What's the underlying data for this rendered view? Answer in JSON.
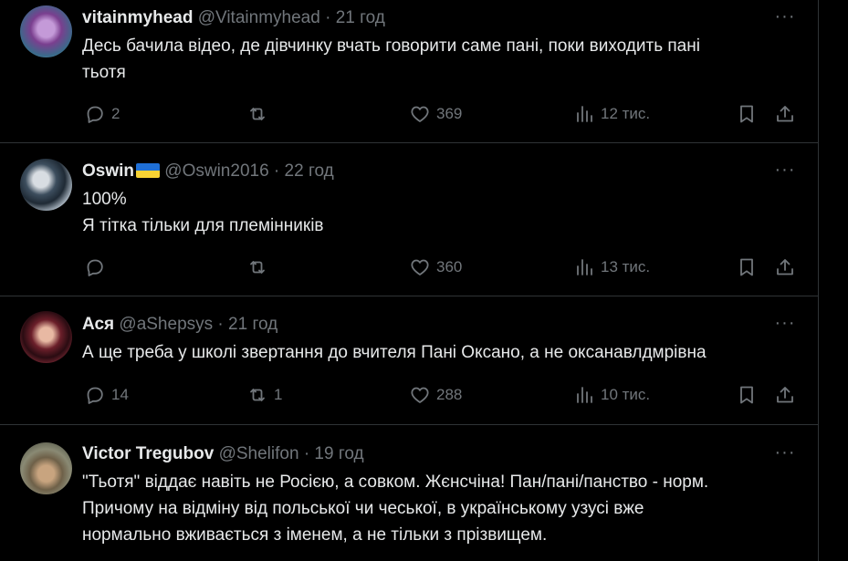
{
  "tweets": [
    {
      "name": "vitainmyhead",
      "handle": "@Vitainmyhead",
      "sep": "·",
      "time": "21 год",
      "text_lines": [
        "Десь бачила відео, де дівчинку вчать говорити саме пані, поки виходить пані",
        "тьотя"
      ],
      "replies": "2",
      "reposts": "",
      "likes": "369",
      "views": "12 тис."
    },
    {
      "name": "Oswin",
      "flag": "ukraine-flag",
      "handle": "@Oswin2016",
      "sep": "·",
      "time": "22 год",
      "text_lines": [
        "100%",
        "Я тітка тільки для племінників"
      ],
      "replies": "",
      "reposts": "",
      "likes": "360",
      "views": "13 тис."
    },
    {
      "name": "Ася",
      "handle": "@aShepsys",
      "sep": "·",
      "time": "21 год",
      "text_lines": [
        "А ще треба у школі звертання до вчителя Пані Оксано, а не оксанавлдмрівна"
      ],
      "replies": "14",
      "reposts": "1",
      "likes": "288",
      "views": "10 тис."
    },
    {
      "name": "Victor Tregubov",
      "handle": "@Shelifon",
      "sep": "·",
      "time": "19 год",
      "text_lines": [
        "\"Тьотя\" віддає навіть не Росією, а совком. Жєнсчіна! Пан/пані/панство - норм.",
        "Причому на відміну від польської чи чеської, в українському узусі вже",
        "нормально вживається з іменем, а не тільки з прізвищем."
      ]
    }
  ],
  "icons": {
    "more": "more-horizontal-icon",
    "reply": "reply-icon",
    "repost": "repost-icon",
    "like": "heart-icon",
    "views": "views-chart-icon",
    "bookmark": "bookmark-icon",
    "share": "share-icon"
  },
  "colors": {
    "background": "#000000",
    "text": "#e7e9ea",
    "muted": "#71767b",
    "divider": "#2f3336"
  }
}
